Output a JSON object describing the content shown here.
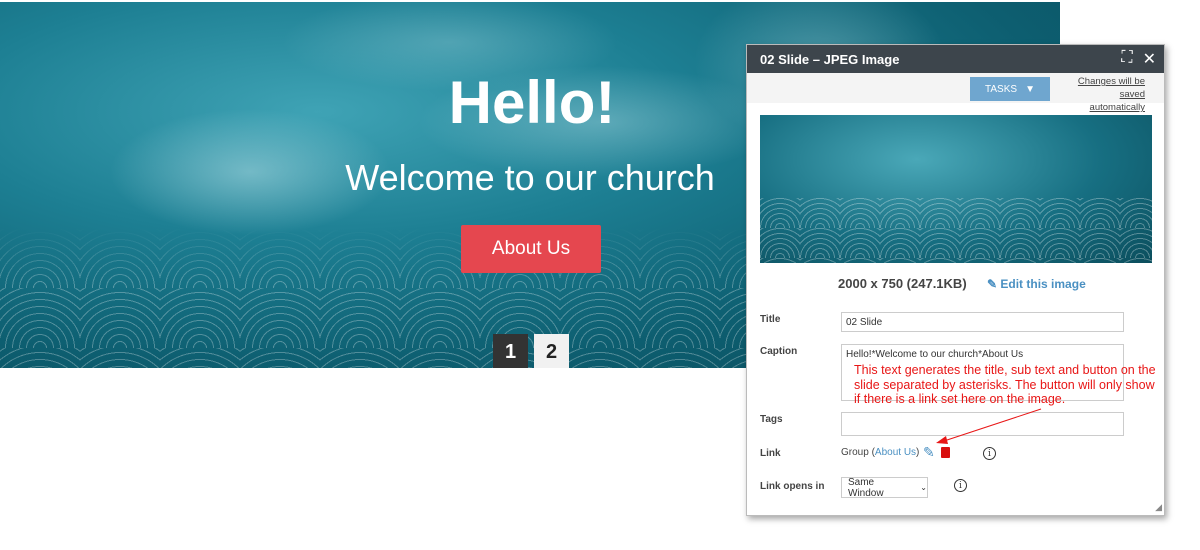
{
  "hero": {
    "title": "Hello!",
    "subtitle": "Welcome to our church",
    "button": "About Us",
    "pages": [
      "1",
      "2"
    ],
    "active_page": "1"
  },
  "dialog": {
    "title": "02 Slide – JPEG Image",
    "tasks_label": "TASKS",
    "autosave_line1": "Changes will be",
    "autosave_line2": "saved automatically",
    "dimensions": "2000 x 750 (247.1KB)",
    "edit_image": "Edit this image",
    "fields": {
      "title_label": "Title",
      "title_value": "02 Slide",
      "caption_label": "Caption",
      "caption_value": "Hello!*Welcome to our church*About Us",
      "tags_label": "Tags",
      "tags_value": "",
      "link_label": "Link",
      "link_prefix": "Group (",
      "link_target": "About Us",
      "link_suffix": ")",
      "link_opens_label": "Link opens in",
      "link_opens_value": "Same Window"
    }
  },
  "annotation": {
    "text": "This text generates the title, sub text and button on the slide separated by asterisks. The button will only show if there is a link set here on the image.",
    "color": "#e81616"
  },
  "colors": {
    "accent_button": "#e5474f",
    "tasks": "#6fa6cf",
    "header": "#3d454c",
    "link": "#4a90c2"
  }
}
